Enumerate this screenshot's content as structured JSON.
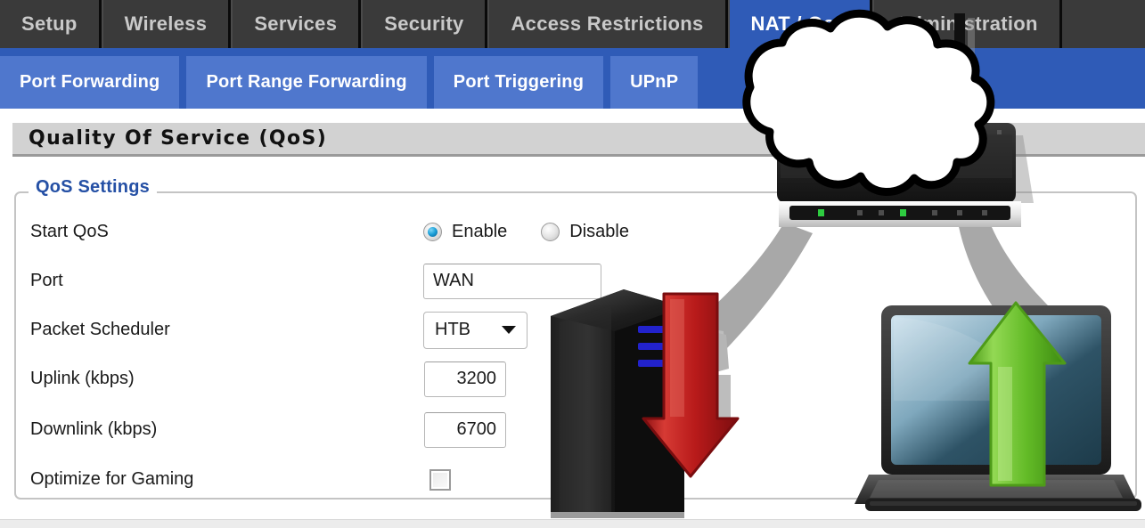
{
  "main_nav": {
    "items": [
      {
        "label": "Setup",
        "active": false
      },
      {
        "label": "Wireless",
        "active": false
      },
      {
        "label": "Services",
        "active": false
      },
      {
        "label": "Security",
        "active": false
      },
      {
        "label": "Access Restrictions",
        "active": false
      },
      {
        "label": "NAT / QoS",
        "active": true
      },
      {
        "label": "Administration",
        "active": false
      }
    ]
  },
  "sub_nav": {
    "items": [
      {
        "label": "Port Forwarding"
      },
      {
        "label": "Port Range Forwarding"
      },
      {
        "label": "Port Triggering"
      },
      {
        "label": "UPnP"
      }
    ]
  },
  "page": {
    "title": "Quality Of Service (QoS)",
    "fieldset_legend": "QoS Settings"
  },
  "form": {
    "start_qos": {
      "label": "Start QoS",
      "options": [
        {
          "label": "Enable",
          "selected": true
        },
        {
          "label": "Disable",
          "selected": false
        }
      ]
    },
    "port": {
      "label": "Port",
      "value": "WAN"
    },
    "packet_scheduler": {
      "label": "Packet Scheduler",
      "value": "HTB"
    },
    "uplink": {
      "label": "Uplink (kbps)",
      "value": "3200"
    },
    "downlink": {
      "label": "Downlink (kbps)",
      "value": "6700"
    },
    "optimize_gaming": {
      "label": "Optimize for Gaming",
      "checked": false
    }
  },
  "illustration": {
    "cloud": "internet-cloud",
    "router": "wireless-router",
    "server": "server-tower",
    "laptop": "laptop-computer",
    "download_arrow": "red-down-arrow",
    "upload_arrow": "green-up-arrow",
    "link_left": "gray-link-arrow-to-server",
    "link_right": "gray-link-arrow-to-laptop"
  },
  "colors": {
    "nav_bg": "#3a3a3a",
    "subnav_bg": "#2f5bb7",
    "subnav_tab": "#4f77cd",
    "accent_blue": "#2550a5",
    "download_red": "#c4161c",
    "upload_green": "#6cc12e",
    "link_gray": "#a8a8a8"
  }
}
